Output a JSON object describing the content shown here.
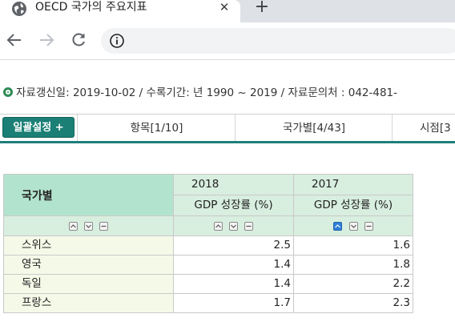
{
  "browser": {
    "tab_title": "OECD 국가의 주요지표",
    "tab_close": "✕",
    "new_tab": "+",
    "icons": [
      "globe-icon",
      "back-arrow-icon",
      "forward-arrow-icon",
      "reload-icon",
      "info-icon"
    ]
  },
  "page": {
    "info_line": "자료갱신일: 2019-10-02 / 수록기간: 년 1990 ~ 2019 / 자료문의처 : 042-481-",
    "bulk_button": "일괄설정 +",
    "tabs": [
      {
        "label": "항목[1/10]"
      },
      {
        "label": "국가별[4/43]"
      },
      {
        "label": "시점[3"
      }
    ]
  },
  "table": {
    "row_header": "국가별",
    "columns": [
      {
        "year": "2018",
        "measure": "GDP 성장률 (%)"
      },
      {
        "year": "2017",
        "measure": "GDP 성장률 (%)"
      }
    ],
    "rows": [
      {
        "name": "스위스",
        "values": [
          "2.5",
          "1.6"
        ]
      },
      {
        "name": "영국",
        "values": [
          "1.4",
          "1.8"
        ]
      },
      {
        "name": "독일",
        "values": [
          "1.4",
          "2.2"
        ]
      },
      {
        "name": "프랑스",
        "values": [
          "1.7",
          "2.3"
        ]
      }
    ]
  },
  "colors": {
    "accent": "#1b7f75",
    "header_country_bg": "#b2e3ce",
    "header_col_bg": "#d8eedf",
    "row_name_bg": "#f5f9e8"
  }
}
